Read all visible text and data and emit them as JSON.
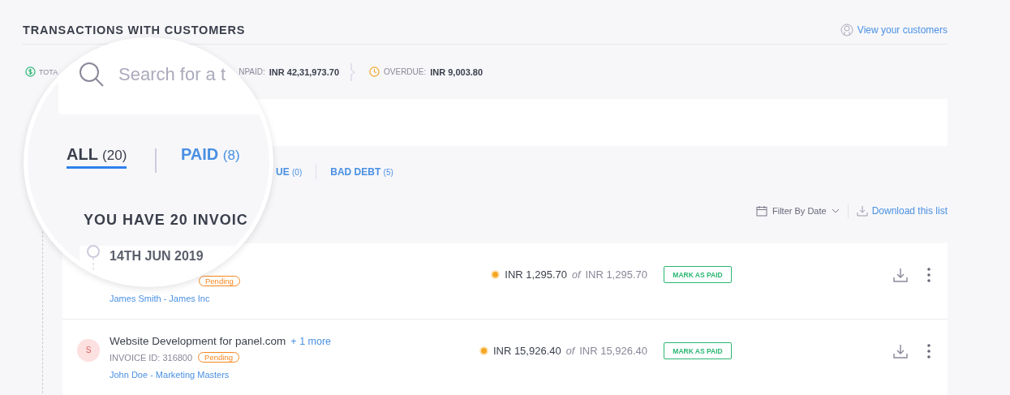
{
  "header": {
    "title": "TRANSACTIONS WITH CUSTOMERS",
    "link": "View your customers"
  },
  "stats": [
    {
      "kind": "total",
      "label": "TOTA"
    },
    {
      "kind": "unpaid",
      "label": "NPAID:",
      "value": "INR 42,31,973.70"
    },
    {
      "kind": "overdue",
      "label": "OVERDUE:",
      "value": "INR 9,003.80"
    }
  ],
  "tabs": [
    {
      "label": "UE",
      "count": "(0)",
      "selected": false
    },
    {
      "label": "BAD DEBT",
      "count": "(5)",
      "selected": false
    }
  ],
  "toolbar": {
    "filter": "Filter By Date",
    "download": "Download this list"
  },
  "invoices": [
    {
      "status": "Pending",
      "customer": "James Smith - James Inc",
      "amount": "INR 1,295.70",
      "of": "of",
      "total": "INR 1,295.70",
      "action": "MARK AS PAID"
    },
    {
      "avatar": "S",
      "title": "Website Development for panel.com",
      "more": "+ 1 more",
      "invoice_id": "INVOICE ID: 316800",
      "status": "Pending",
      "customer": "John Doe - Marketing Masters",
      "amount": "INR 15,926.40",
      "of": "of",
      "total": "INR 15,926.40",
      "action": "MARK AS PAID"
    }
  ],
  "magnifier": {
    "search_placeholder": "Search for a t",
    "tabs": [
      {
        "label": "ALL",
        "count": "(20)",
        "selected": true
      },
      {
        "label": "PAID",
        "count": "(8)",
        "selected": false
      }
    ],
    "heading": "YOU HAVE 20 INVOIC",
    "date": "14TH JUN 2019"
  }
}
